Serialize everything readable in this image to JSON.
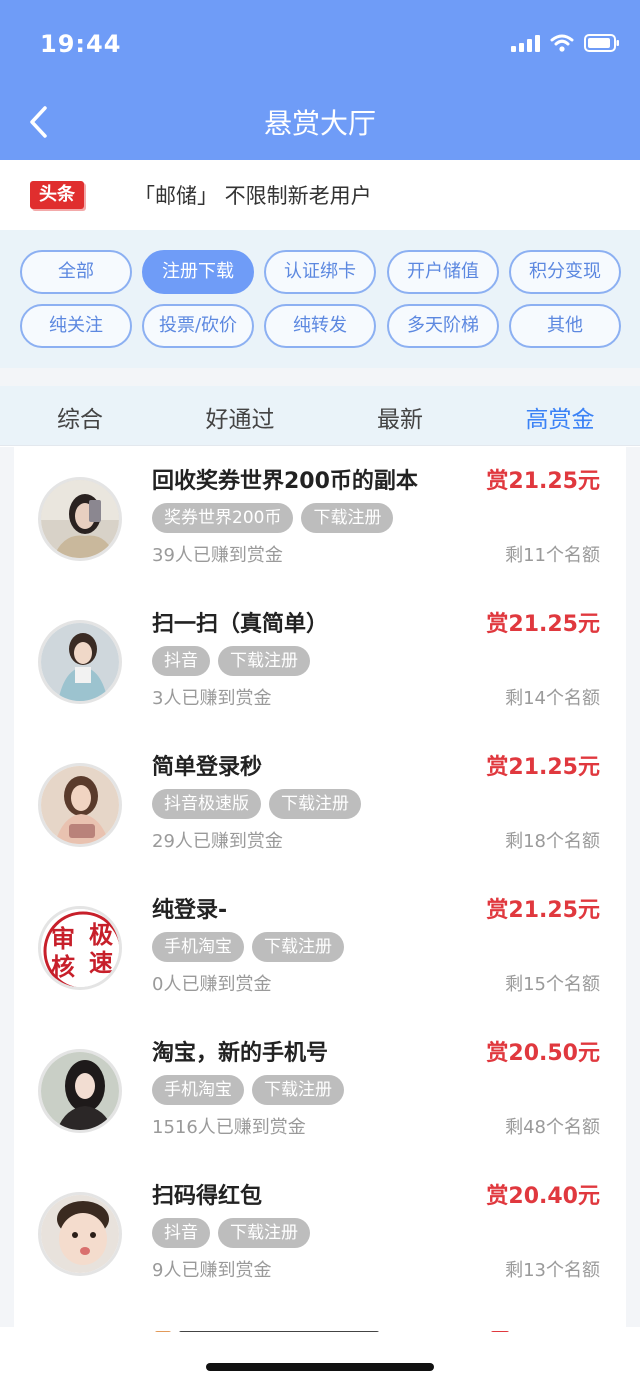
{
  "status_bar": {
    "time": "19:44"
  },
  "nav": {
    "title": "悬赏大厅"
  },
  "notice": {
    "badge": "头条",
    "text": "「邮储」 不限制新老用户"
  },
  "categories": [
    {
      "label": "全部"
    },
    {
      "label": "注册下载",
      "active": true
    },
    {
      "label": "认证绑卡"
    },
    {
      "label": "开户储值"
    },
    {
      "label": "积分变现"
    },
    {
      "label": "纯关注"
    },
    {
      "label": "投票/砍价"
    },
    {
      "label": "纯转发"
    },
    {
      "label": "多天阶梯"
    },
    {
      "label": "其他"
    }
  ],
  "sort_tabs": [
    {
      "label": "综合"
    },
    {
      "label": "好通过"
    },
    {
      "label": "最新"
    },
    {
      "label": "高赏金",
      "active": true
    }
  ],
  "tasks": [
    {
      "title": "回收奖券世界200币的副本",
      "reward": "赏21.25元",
      "tags": [
        "奖券世界200币",
        "下载注册"
      ],
      "earned": "39人已赚到赏金",
      "remaining": "剩11个名额",
      "avatar": "photo"
    },
    {
      "title": "扫一扫（真简单）",
      "reward": "赏21.25元",
      "tags": [
        "抖音",
        "下载注册"
      ],
      "earned": "3人已赚到赏金",
      "remaining": "剩14个名额",
      "avatar": "photo"
    },
    {
      "title": "简单登录秒",
      "reward": "赏21.25元",
      "tags": [
        "抖音极速版",
        "下载注册"
      ],
      "earned": "29人已赚到赏金",
      "remaining": "剩18个名额",
      "avatar": "photo"
    },
    {
      "title": "纯登录-",
      "reward": "赏21.25元",
      "tags": [
        "手机淘宝",
        "下载注册"
      ],
      "earned": "0人已赚到赏金",
      "remaining": "剩15个名额",
      "avatar": "stamp",
      "stamp_text": [
        "审",
        "极",
        "核",
        "速"
      ]
    },
    {
      "title": "淘宝，新的手机号",
      "reward": "赏20.50元",
      "tags": [
        "手机淘宝",
        "下载注册"
      ],
      "earned": "1516人已赚到赏金",
      "remaining": "剩48个名额",
      "avatar": "photo"
    },
    {
      "title": "扫码得红包",
      "reward": "赏20.40元",
      "tags": [
        "抖音",
        "下载注册"
      ],
      "earned": "9人已赚到赏金",
      "remaining": "剩13个名额",
      "avatar": "photo"
    }
  ],
  "colors": {
    "brand": "#6f9cf7",
    "reward": "#e0383e",
    "badge": "#e02e2e",
    "active_tab": "#3b82f6"
  }
}
